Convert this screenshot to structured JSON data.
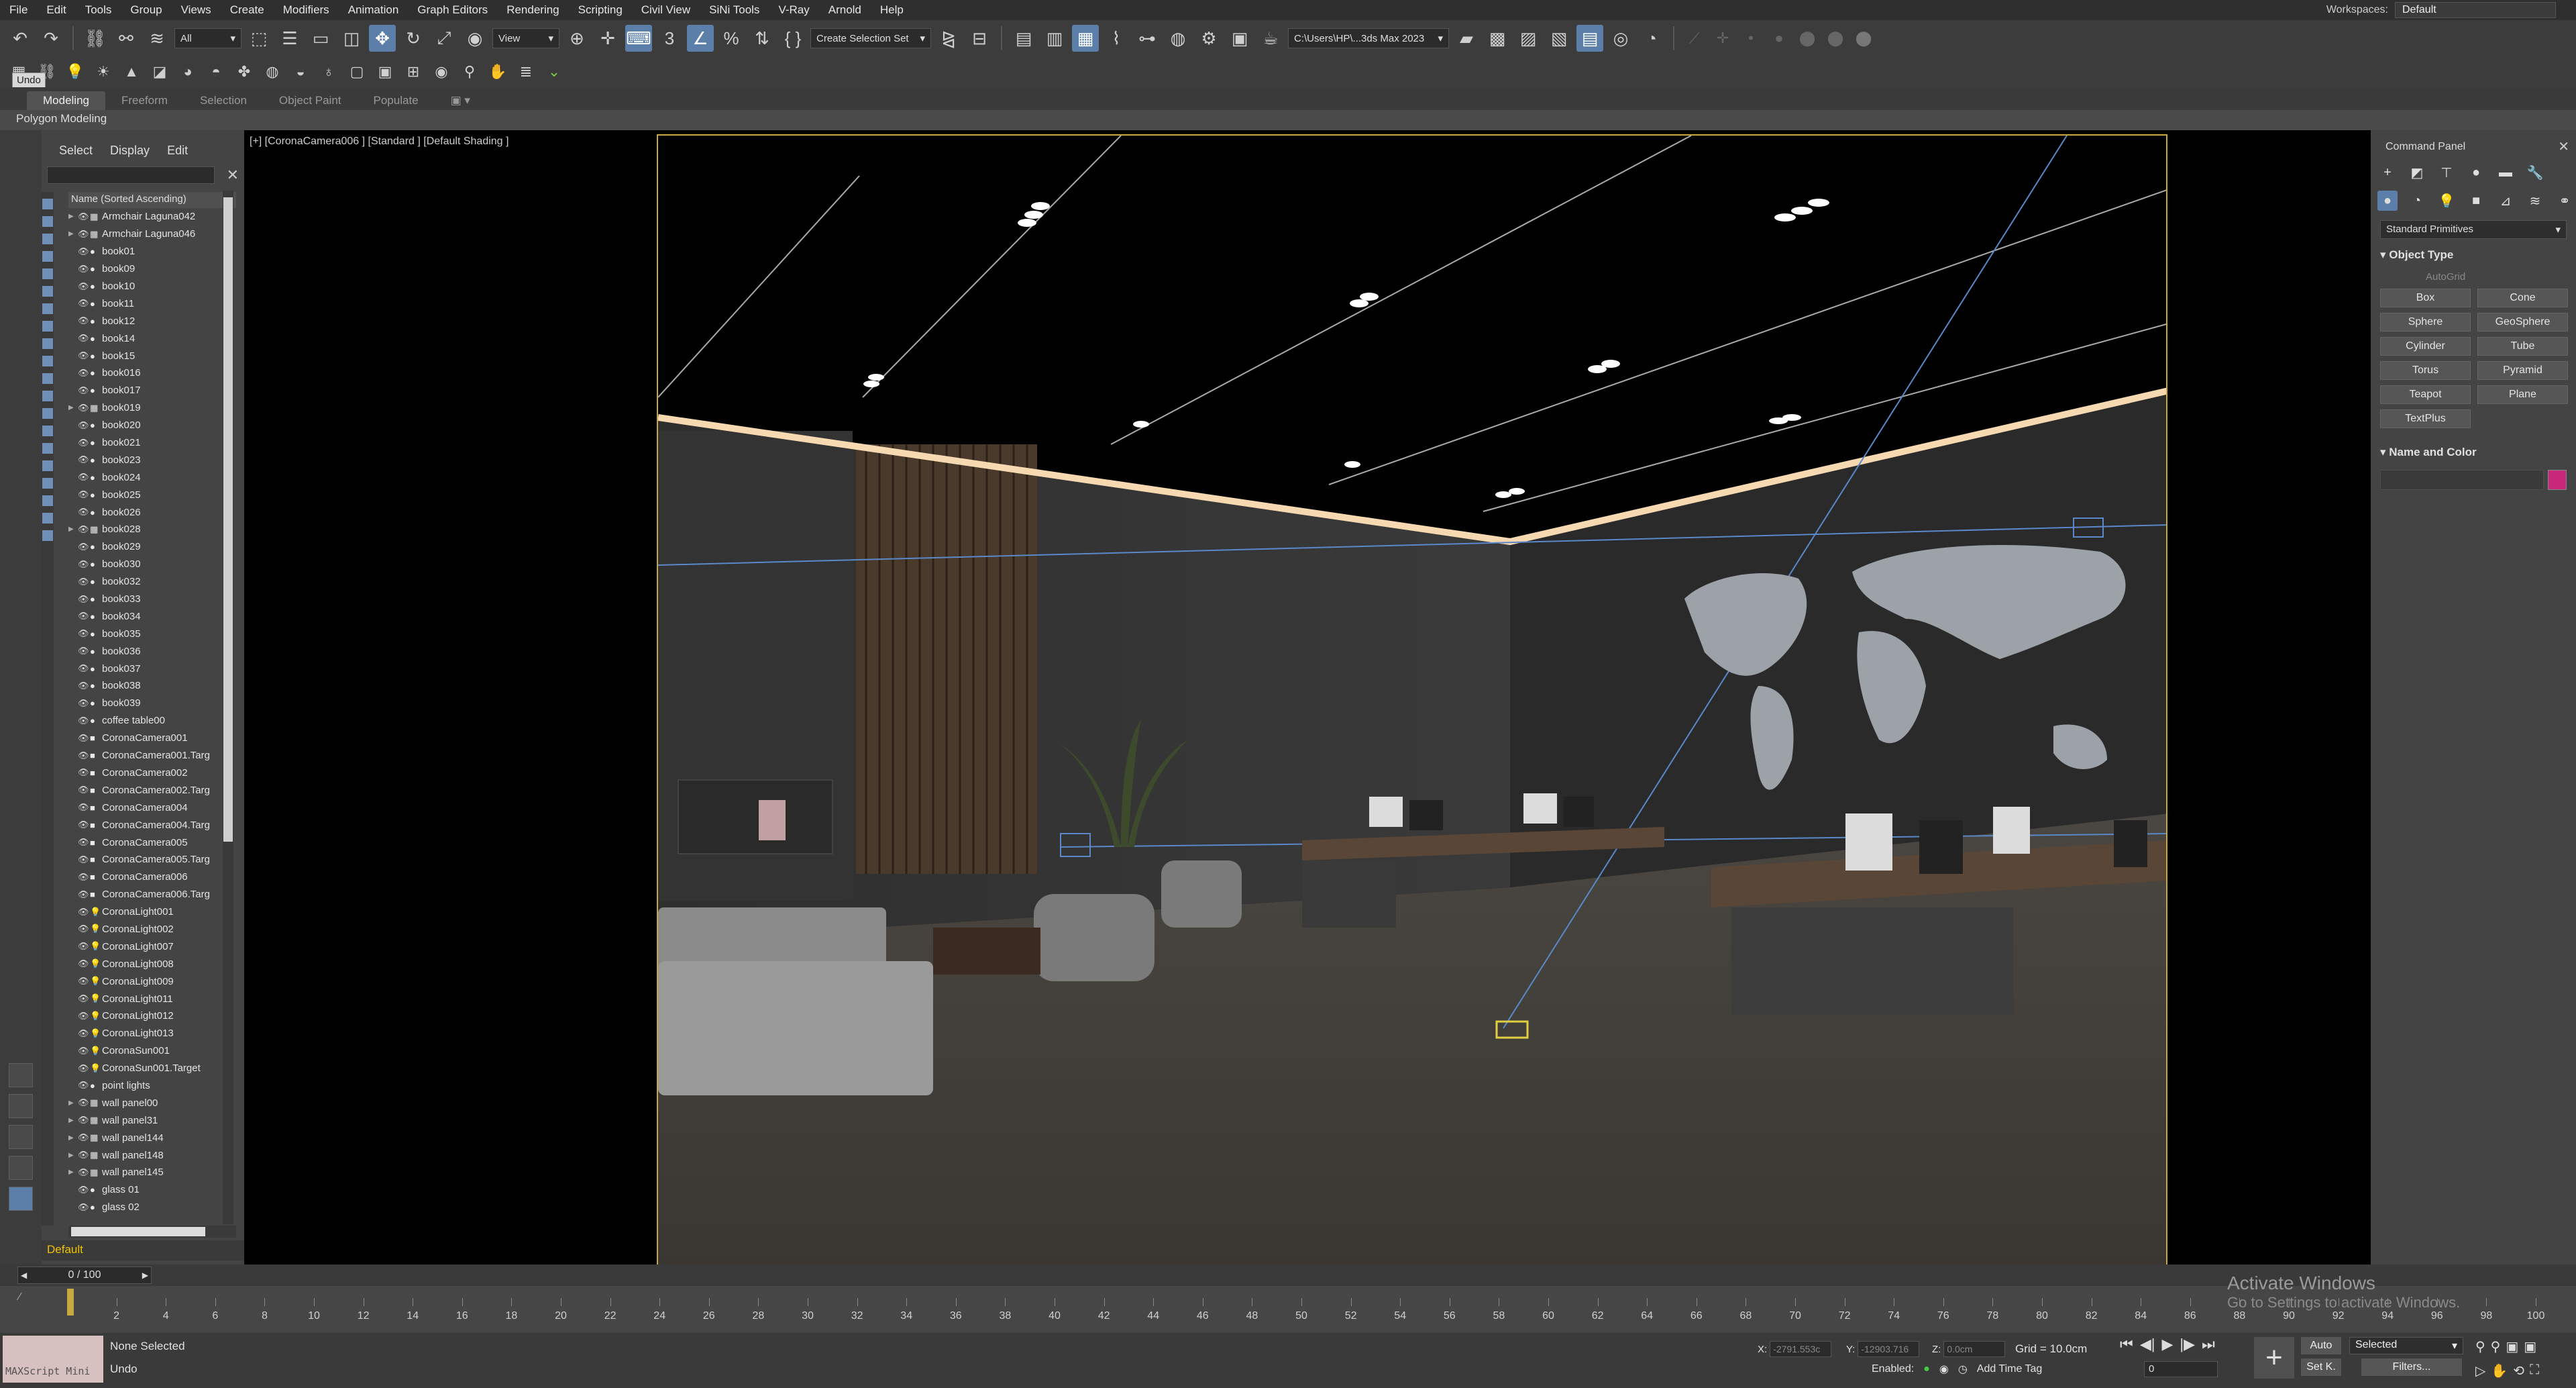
{
  "menu": [
    "File",
    "Edit",
    "Tools",
    "Group",
    "Views",
    "Create",
    "Modifiers",
    "Animation",
    "Graph Editors",
    "Rendering",
    "Scripting",
    "Civil View",
    "SiNi Tools",
    "V-Ray",
    "Arnold",
    "Help"
  ],
  "workspace": {
    "label": "Workspaces:",
    "value": "Default"
  },
  "toolbar": {
    "filter_all": "All",
    "ref_coord": "View",
    "selection_set": "Create Selection Set",
    "project_path": "C:\\Users\\HP\\...3ds Max 2023"
  },
  "tooltip_undo": "Undo",
  "ribbon": {
    "tabs": [
      "Modeling",
      "Freeform",
      "Selection",
      "Object Paint",
      "Populate"
    ],
    "active": "Modeling",
    "sub": "Polygon Modeling"
  },
  "scene_explorer": {
    "tabs": [
      "Select",
      "Display",
      "Edit"
    ],
    "column_header": "Name (Sorted Ascending)",
    "items": [
      {
        "name": "Armchair Laguna042",
        "icon": "group",
        "expand": true
      },
      {
        "name": "Armchair Laguna046",
        "icon": "group",
        "expand": true
      },
      {
        "name": "book01",
        "icon": "object",
        "expand": false
      },
      {
        "name": "book09",
        "icon": "object",
        "expand": false
      },
      {
        "name": "book10",
        "icon": "object",
        "expand": false
      },
      {
        "name": "book11",
        "icon": "object",
        "expand": false
      },
      {
        "name": "book12",
        "icon": "object",
        "expand": false
      },
      {
        "name": "book14",
        "icon": "object",
        "expand": false
      },
      {
        "name": "book15",
        "icon": "object",
        "expand": false
      },
      {
        "name": "book016",
        "icon": "object",
        "expand": false
      },
      {
        "name": "book017",
        "icon": "object",
        "expand": false
      },
      {
        "name": "book019",
        "icon": "group",
        "expand": true
      },
      {
        "name": "book020",
        "icon": "object",
        "expand": false
      },
      {
        "name": "book021",
        "icon": "object",
        "expand": false
      },
      {
        "name": "book023",
        "icon": "object",
        "expand": false
      },
      {
        "name": "book024",
        "icon": "object",
        "expand": false
      },
      {
        "name": "book025",
        "icon": "object",
        "expand": false
      },
      {
        "name": "book026",
        "icon": "object",
        "expand": false
      },
      {
        "name": "book028",
        "icon": "group",
        "expand": true
      },
      {
        "name": "book029",
        "icon": "object",
        "expand": false
      },
      {
        "name": "book030",
        "icon": "object",
        "expand": false
      },
      {
        "name": "book032",
        "icon": "object",
        "expand": false
      },
      {
        "name": "book033",
        "icon": "object",
        "expand": false
      },
      {
        "name": "book034",
        "icon": "object",
        "expand": false
      },
      {
        "name": "book035",
        "icon": "object",
        "expand": false
      },
      {
        "name": "book036",
        "icon": "object",
        "expand": false
      },
      {
        "name": "book037",
        "icon": "object",
        "expand": false
      },
      {
        "name": "book038",
        "icon": "object",
        "expand": false
      },
      {
        "name": "book039",
        "icon": "object",
        "expand": false
      },
      {
        "name": "coffee table00",
        "icon": "object",
        "expand": false
      },
      {
        "name": "CoronaCamera001",
        "icon": "camera",
        "expand": false
      },
      {
        "name": "CoronaCamera001.Targ",
        "icon": "camera",
        "expand": false
      },
      {
        "name": "CoronaCamera002",
        "icon": "camera",
        "expand": false
      },
      {
        "name": "CoronaCamera002.Targ",
        "icon": "camera",
        "expand": false
      },
      {
        "name": "CoronaCamera004",
        "icon": "camera",
        "expand": false
      },
      {
        "name": "CoronaCamera004.Targ",
        "icon": "camera",
        "expand": false
      },
      {
        "name": "CoronaCamera005",
        "icon": "camera",
        "expand": false
      },
      {
        "name": "CoronaCamera005.Targ",
        "icon": "camera",
        "expand": false
      },
      {
        "name": "CoronaCamera006",
        "icon": "camera",
        "expand": false
      },
      {
        "name": "CoronaCamera006.Targ",
        "icon": "camera",
        "expand": false
      },
      {
        "name": "CoronaLight001",
        "icon": "light",
        "expand": false
      },
      {
        "name": "CoronaLight002",
        "icon": "light",
        "expand": false
      },
      {
        "name": "CoronaLight007",
        "icon": "light",
        "expand": false
      },
      {
        "name": "CoronaLight008",
        "icon": "light",
        "expand": false
      },
      {
        "name": "CoronaLight009",
        "icon": "light",
        "expand": false
      },
      {
        "name": "CoronaLight011",
        "icon": "light",
        "expand": false
      },
      {
        "name": "CoronaLight012",
        "icon": "light",
        "expand": false
      },
      {
        "name": "CoronaLight013",
        "icon": "light",
        "expand": false
      },
      {
        "name": "CoronaSun001",
        "icon": "light",
        "expand": false
      },
      {
        "name": "CoronaSun001.Target",
        "icon": "light",
        "expand": false
      },
      {
        "name": "point lights",
        "icon": "object",
        "expand": false
      },
      {
        "name": "wall panel00",
        "icon": "group",
        "expand": true
      },
      {
        "name": "wall panel31",
        "icon": "group",
        "expand": true
      },
      {
        "name": "wall panel144",
        "icon": "group",
        "expand": true
      },
      {
        "name": "wall panel148",
        "icon": "group",
        "expand": true
      },
      {
        "name": "wall panel145",
        "icon": "group",
        "expand": true
      },
      {
        "name": "glass 01",
        "icon": "object",
        "expand": false
      },
      {
        "name": "glass 02",
        "icon": "object",
        "expand": false
      }
    ],
    "layer": "Default"
  },
  "viewport": {
    "label": "[+] [CoronaCamera006 ] [Standard ] [Default Shading ]"
  },
  "command_panel": {
    "title": "Command Panel",
    "category": "Standard Primitives",
    "object_type_title": "Object Type",
    "autogrid": "AutoGrid",
    "primitives": [
      "Box",
      "Cone",
      "Sphere",
      "GeoSphere",
      "Cylinder",
      "Tube",
      "Torus",
      "Pyramid",
      "Teapot",
      "Plane",
      "TextPlus"
    ],
    "name_color_title": "Name and Color",
    "swatch_color": "#c8287a"
  },
  "timeline": {
    "frame": "0 / 100",
    "current": 0,
    "end": 100
  },
  "ticks": [
    0,
    2,
    4,
    6,
    8,
    10,
    12,
    14,
    16,
    18,
    20,
    22,
    24,
    26,
    28,
    30,
    32,
    34,
    36,
    38,
    40,
    42,
    44,
    46,
    48,
    50,
    52,
    54,
    56,
    58,
    60,
    62,
    64,
    66,
    68,
    70,
    72,
    74,
    76,
    78,
    80,
    82,
    84,
    86,
    88,
    90,
    92,
    94,
    96,
    98,
    100
  ],
  "status": {
    "maxscript": "MAXScript Mini",
    "selection": "None Selected",
    "prompt": "Undo",
    "x_label": "X:",
    "x_value": "-2791.553c",
    "y_label": "Y:",
    "y_value": "-12903.716",
    "z_label": "Z:",
    "z_value": "0.0cm",
    "grid": "Grid = 10.0cm",
    "enabled": "Enabled:",
    "add_time_tag": "Add Time Tag",
    "auto": "Auto",
    "setk": "Set K.",
    "selected": "Selected",
    "filters": "Filters...",
    "spinner": "0"
  },
  "watermark": {
    "title": "Activate Windows",
    "sub": "Go to Settings to activate Windows."
  }
}
